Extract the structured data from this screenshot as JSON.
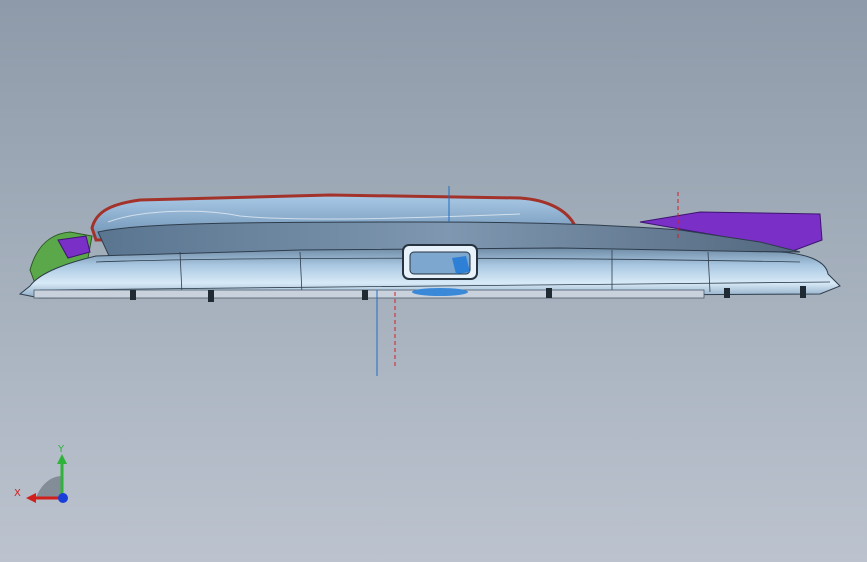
{
  "viewport": {
    "background_top": "#8e9aa9",
    "background_bottom": "#bcc3cf"
  },
  "model": {
    "body_color": "#9fc1dc",
    "rim_color": "#a2322a",
    "accent_purple": "#7a2fc6",
    "accent_green": "#5aa84a",
    "axis_blue": "#1f6fc4",
    "axis_red": "#d02020"
  },
  "triad": {
    "x_label": "X",
    "y_label": "Y",
    "x_color": "#d0201b",
    "y_color": "#2fb33a",
    "z_color": "#1a3fd8"
  }
}
